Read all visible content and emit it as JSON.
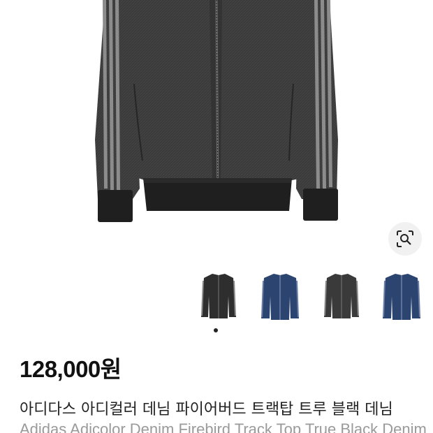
{
  "product": {
    "price": "128,000원",
    "title_ko": "아디다스 아디컬러 데님 파이어버드 트랙탑 트루 블랙 데님",
    "title_en": "Adidas Adicolor Denim Firebird Track Top True Black Denim"
  },
  "gallery": {
    "main_image": "black-denim-track-top",
    "lens_icon": "image-search-lens-icon",
    "thumbnails": [
      {
        "variant": "black-denim",
        "color": "#2e2e2e",
        "stripe": "#8a8a8a"
      },
      {
        "variant": "blue-denim",
        "color": "#2c4470",
        "stripe": "#6b7fa6"
      },
      {
        "variant": "black-denim",
        "color": "#3a3a3a",
        "stripe": "#8a8a8a"
      },
      {
        "variant": "blue-denim",
        "color": "#2c4470",
        "stripe": "#6b7fa6"
      }
    ],
    "active_index": 0
  },
  "colors": {
    "jacket_body": "#3b3b3b",
    "jacket_rib": "#1f1f1f",
    "stripe": "#8c8c8c",
    "text_primary": "#111111",
    "text_secondary": "#9a9a9a"
  }
}
